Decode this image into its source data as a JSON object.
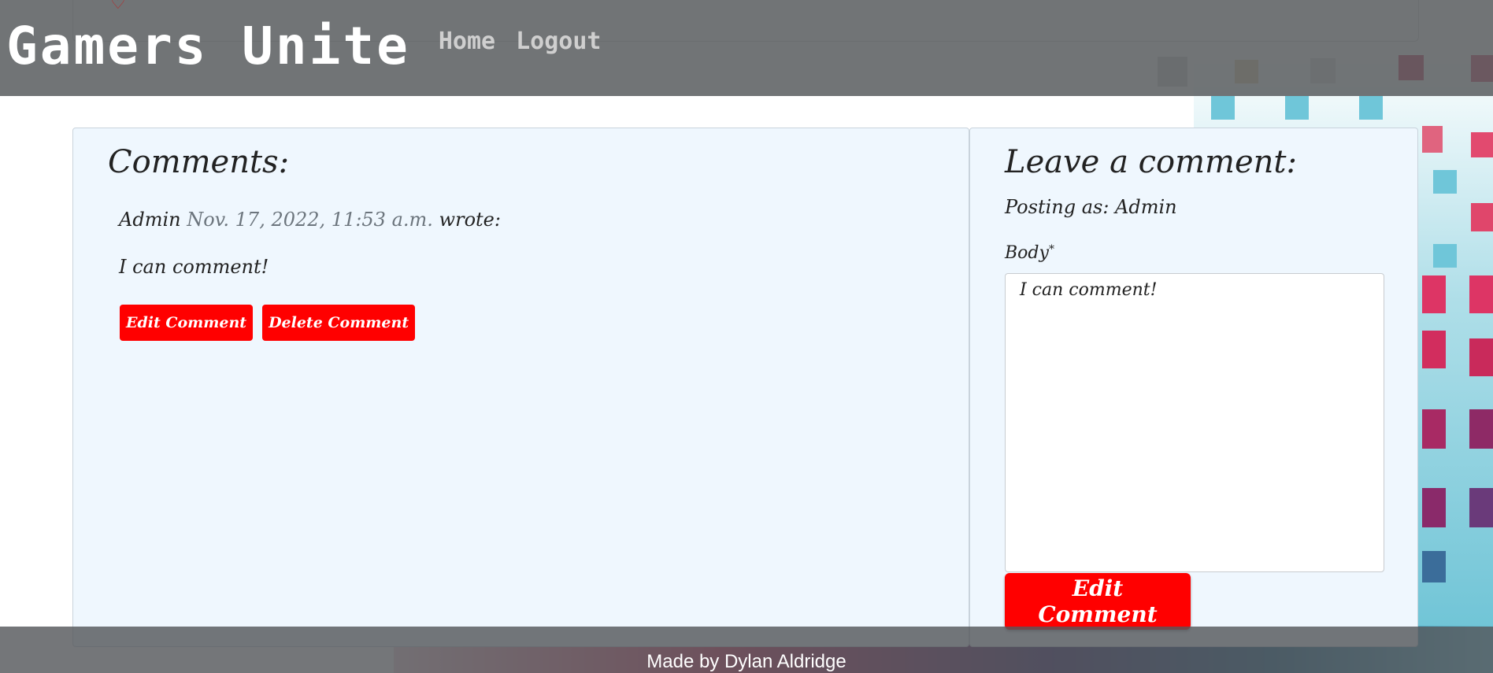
{
  "nav": {
    "brand": "Gamers Unite",
    "links": [
      {
        "label": "Home"
      },
      {
        "label": "Logout"
      }
    ]
  },
  "comments_panel": {
    "title": "Comments:",
    "comment": {
      "author": "Admin",
      "date": "Nov. 17, 2022, 11:53 a.m.",
      "suffix": "wrote:",
      "body": "I can comment!",
      "edit_label": "Edit Comment",
      "delete_label": "Delete Comment"
    }
  },
  "form_panel": {
    "title": "Leave a comment:",
    "posting_as": "Posting as: Admin",
    "body_label": "Body",
    "required_mark": "*",
    "body_value": "I can comment!",
    "submit_label": "Edit Comment"
  },
  "footer": {
    "text": "Made by Dylan Aldridge"
  },
  "colors": {
    "accent": "#ff0000",
    "panel_bg": "#eff7fe",
    "navbar_bg": "#5a5d60"
  },
  "icons": [
    "heart-icon",
    "comment-icon",
    "resize-grip-icon"
  ]
}
